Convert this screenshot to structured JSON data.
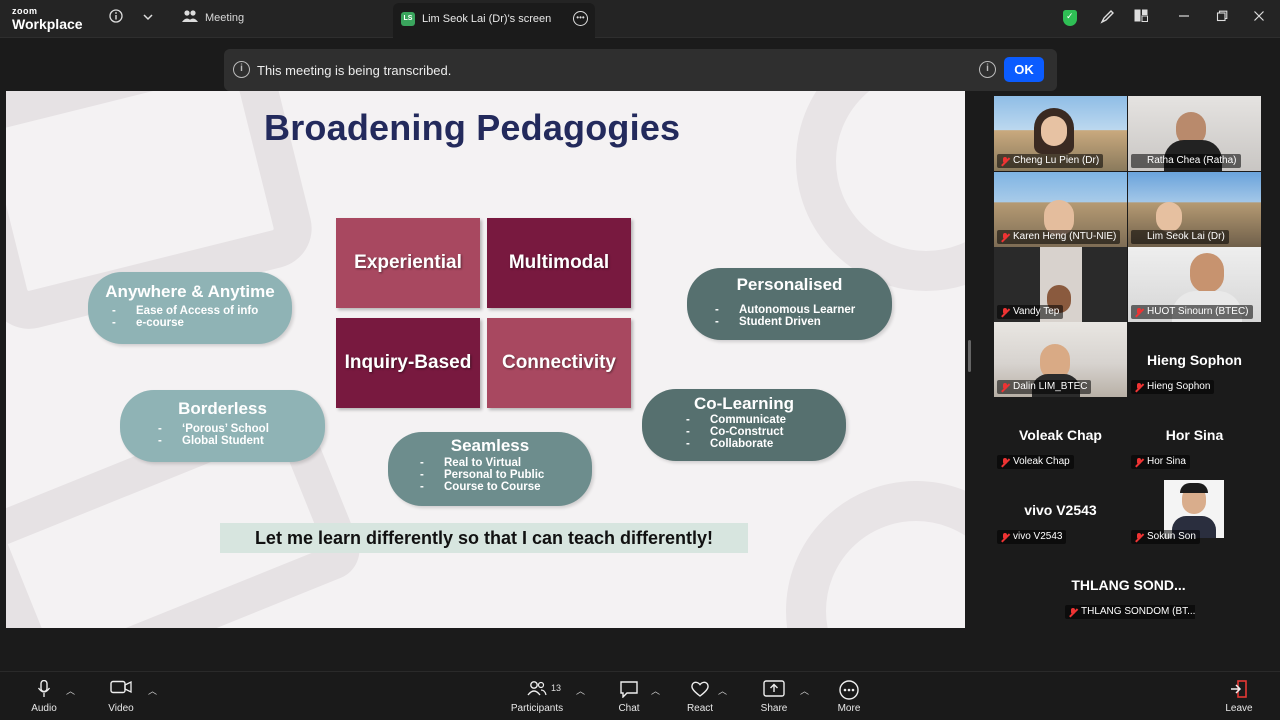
{
  "app": {
    "brand_top": "zoom",
    "brand_bottom": "Workplace"
  },
  "titlebar": {
    "meeting_label": "Meeting",
    "screen_tab_badge": "LS",
    "screen_tab_label": "Lim Seok Lai (Dr)'s screen",
    "icons": [
      "info-icon",
      "chevron-down-icon",
      "people-icon",
      "more-icon",
      "shield-icon",
      "pen-icon",
      "layout-icon",
      "minimize-icon",
      "restore-icon",
      "close-icon"
    ]
  },
  "banner": {
    "text": "This meeting is being transcribed.",
    "ok_label": "OK"
  },
  "slide": {
    "title": "Broadening Pedagogies",
    "squares": [
      "Experiential",
      "Multimodal",
      "Inquiry-Based",
      "Connectivity"
    ],
    "anywhere": {
      "title": "Anywhere & Anytime",
      "items": [
        "Ease of Access of info",
        "e-course"
      ]
    },
    "personalised": {
      "title": "Personalised",
      "items": [
        "Autonomous Learner",
        "Student Driven"
      ]
    },
    "borderless": {
      "title": "Borderless",
      "items": [
        "‘Porous’ School",
        "Global Student"
      ]
    },
    "colearning": {
      "title": "Co-Learning",
      "items": [
        "Communicate",
        "Co-Construct",
        "Collaborate"
      ]
    },
    "seamless": {
      "title": "Seamless",
      "items": [
        "Real to Virtual",
        "Personal to Public",
        "Course to Course"
      ]
    },
    "motto": "Let me learn differently so that I can teach differently!"
  },
  "participants": {
    "video": [
      {
        "name": "Cheng Lu Pien (Dr)"
      },
      {
        "name": "Ratha Chea (Ratha)"
      },
      {
        "name": "Karen Heng (NTU-NIE)"
      },
      {
        "name": "Lim Seok Lai (Dr)"
      },
      {
        "name": "Vandy Tep"
      },
      {
        "name": "HUOT Sinourn (BTEC)"
      },
      {
        "name": "Dalin LIM_BTEC"
      }
    ],
    "no_video": [
      {
        "big": "Hieng Sophon",
        "tag": "Hieng Sophon"
      },
      {
        "big": "Voleak Chap",
        "tag": "Voleak Chap"
      },
      {
        "big": "Hor Sina",
        "tag": "Hor Sina"
      },
      {
        "big": "vivo V2543",
        "tag": "vivo V2543"
      },
      {
        "big": "",
        "tag": "Sokun Son"
      },
      {
        "big": "THLANG  SOND...",
        "tag": "THLANG SONDOM (BT..."
      }
    ]
  },
  "toolbar": {
    "audio": "Audio",
    "video": "Video",
    "participants": "Participants",
    "participants_count": "13",
    "chat": "Chat",
    "react": "React",
    "share": "Share",
    "more": "More",
    "leave": "Leave"
  }
}
